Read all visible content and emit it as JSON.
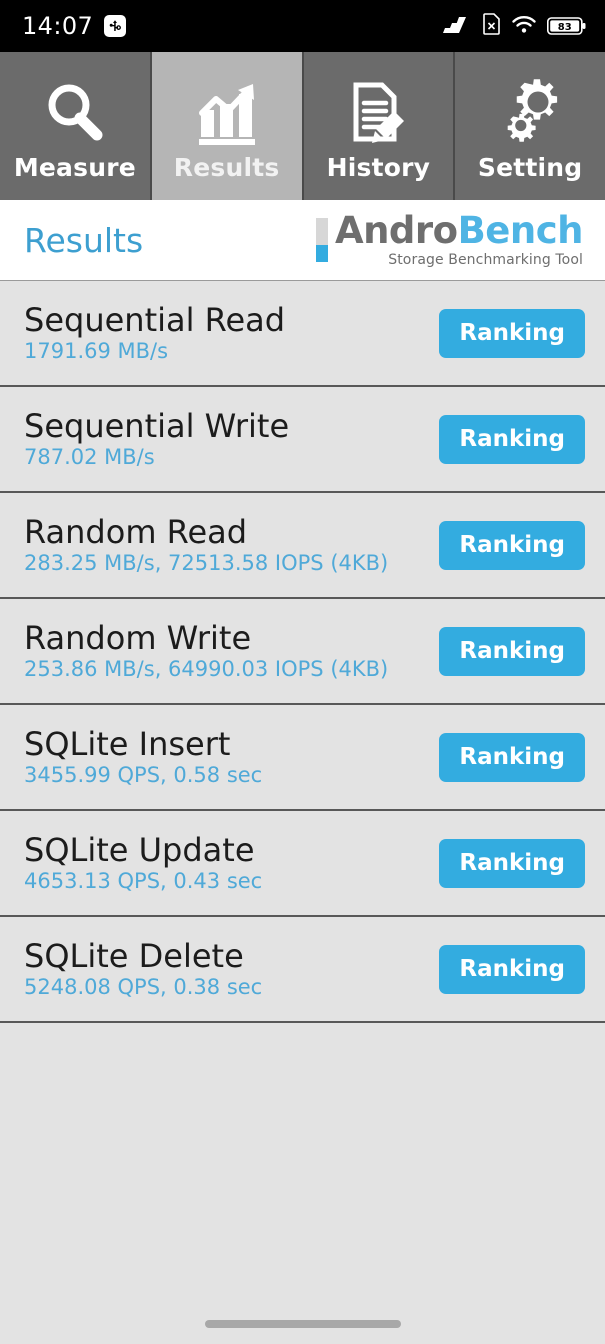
{
  "status_bar": {
    "time": "14:07",
    "usb_icon": "usb-debugging-icon",
    "signal_icon": "signal-bars-icon",
    "sim_icon": "no-sim-card-icon",
    "wifi_icon": "wifi-icon",
    "battery_icon": "battery-icon",
    "battery_level": "83"
  },
  "tabs": [
    {
      "label": "Measure",
      "icon": "magnifier-icon",
      "active": false
    },
    {
      "label": "Results",
      "icon": "bar-chart-trend-icon",
      "active": true
    },
    {
      "label": "History",
      "icon": "document-pencil-icon",
      "active": false
    },
    {
      "label": "Setting",
      "icon": "gears-icon",
      "active": false
    }
  ],
  "header": {
    "title": "Results",
    "logo_primary": "Andro",
    "logo_secondary": "Bench",
    "logo_tagline": "Storage Benchmarking Tool"
  },
  "results": [
    {
      "title": "Sequential Read",
      "value": "1791.69 MB/s",
      "button": "Ranking"
    },
    {
      "title": "Sequential Write",
      "value": "787.02 MB/s",
      "button": "Ranking"
    },
    {
      "title": "Random Read",
      "value": "283.25 MB/s, 72513.58 IOPS (4KB)",
      "button": "Ranking"
    },
    {
      "title": "Random Write",
      "value": "253.86 MB/s, 64990.03 IOPS (4KB)",
      "button": "Ranking"
    },
    {
      "title": "SQLite Insert",
      "value": "3455.99 QPS, 0.58 sec",
      "button": "Ranking"
    },
    {
      "title": "SQLite Update",
      "value": "4653.13 QPS, 0.43 sec",
      "button": "Ranking"
    },
    {
      "title": "SQLite Delete",
      "value": "5248.08 QPS, 0.38 sec",
      "button": "Ranking"
    }
  ],
  "colors": {
    "accent_blue": "#33ace0",
    "value_blue": "#4fa9d8",
    "title_blue": "#3d9fd0",
    "tab_inactive": "#6b6b6b",
    "tab_active": "#b5b5b5",
    "list_background": "#e3e3e3"
  },
  "navigation": {
    "gesture_pill": "home-gesture-pill"
  }
}
